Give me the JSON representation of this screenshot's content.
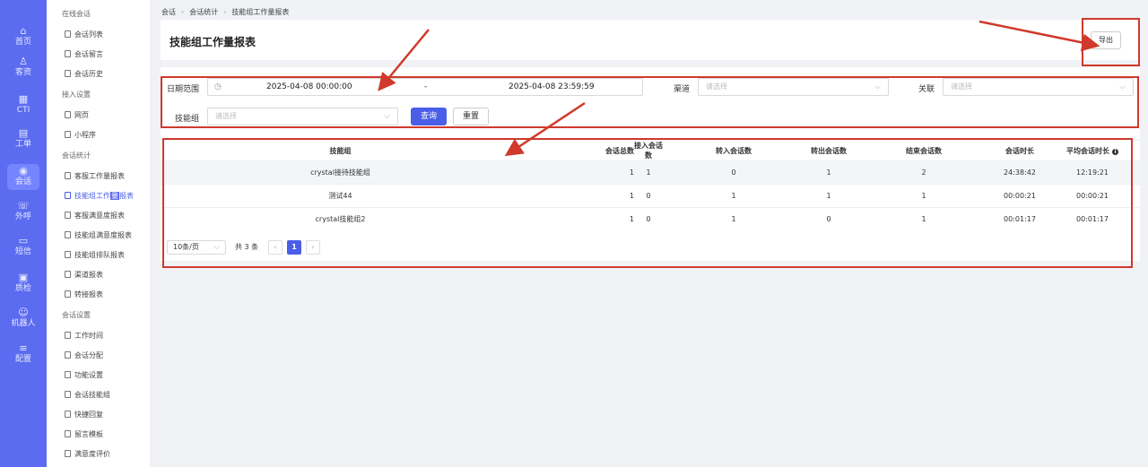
{
  "nav_rail": [
    {
      "label": "首页",
      "icon": "home-icon",
      "glyph": "⌂"
    },
    {
      "label": "客资",
      "icon": "users-icon",
      "glyph": "♙"
    },
    {
      "label": "CTI",
      "icon": "cti-icon",
      "glyph": "▦"
    },
    {
      "label": "工单",
      "icon": "ticket-icon",
      "glyph": "▤"
    },
    {
      "label": "会话",
      "icon": "chat-icon",
      "glyph": "◉"
    },
    {
      "label": "外呼",
      "icon": "phone-icon",
      "glyph": "☏"
    },
    {
      "label": "短信",
      "icon": "sms-icon",
      "glyph": "▭"
    },
    {
      "label": "质检",
      "icon": "inspect-icon",
      "glyph": "▣"
    },
    {
      "label": "机器人",
      "icon": "robot-icon",
      "glyph": "☺"
    },
    {
      "label": "配置",
      "icon": "settings-icon",
      "glyph": "≡"
    }
  ],
  "sidebar": {
    "sections": [
      {
        "title": "在线会话",
        "items": [
          "会话列表",
          "会话留言",
          "会话历史"
        ]
      },
      {
        "title": "接入设置",
        "items": [
          "网页",
          "小程序"
        ]
      },
      {
        "title": "会话统计",
        "items": [
          "客服工作量报表",
          "技能组工作量报表",
          "客服满意度报表",
          "技能组满意度报表",
          "技能组排队报表",
          "渠道报表",
          "转接报表"
        ]
      },
      {
        "title": "会话设置",
        "items": [
          "工作时间",
          "会话分配",
          "功能设置",
          "会话技能组",
          "快捷回复",
          "留言模板",
          "满意度评价"
        ]
      }
    ],
    "active_item_prefix": "技能组工作",
    "active_item_highlight": "量",
    "active_item_suffix": "报表"
  },
  "breadcrumb": [
    "会话",
    "会话统计",
    "技能组工作量报表"
  ],
  "page_title": "技能组工作量报表",
  "export_label": "导出",
  "filters": {
    "date_label": "日期范围",
    "date_start": "2025-04-08 00:00:00",
    "date_sep": "-",
    "date_end": "2025-04-08 23:59:59",
    "channel_label": "渠道",
    "channel_placeholder": "请选择",
    "relation_label": "关联",
    "relation_placeholder": "请选择",
    "group_label": "技能组",
    "group_placeholder": "请选择",
    "query_label": "查询",
    "reset_label": "重置"
  },
  "table": {
    "columns": [
      "技能组",
      "会话总数",
      "接入会话数",
      "转入会话数",
      "转出会话数",
      "结束会话数",
      "会话时长",
      "平均会话时长"
    ],
    "rows": [
      [
        "crystal接待技能组",
        "1",
        "1",
        "0",
        "1",
        "2",
        "24:38:42",
        "12:19:21"
      ],
      [
        "测试44",
        "1",
        "0",
        "1",
        "1",
        "1",
        "00:00:21",
        "00:00:21"
      ],
      [
        "crystal技能组2",
        "1",
        "0",
        "1",
        "0",
        "1",
        "00:01:17",
        "00:01:17"
      ]
    ]
  },
  "pagination": {
    "page_size": "10条/页",
    "total": "共 3 条",
    "prev": "‹",
    "current": "1",
    "next": "›"
  },
  "colors": {
    "brand": "#5b6cf0",
    "primary": "#4a5ee8",
    "annotation": "#d0392b"
  }
}
